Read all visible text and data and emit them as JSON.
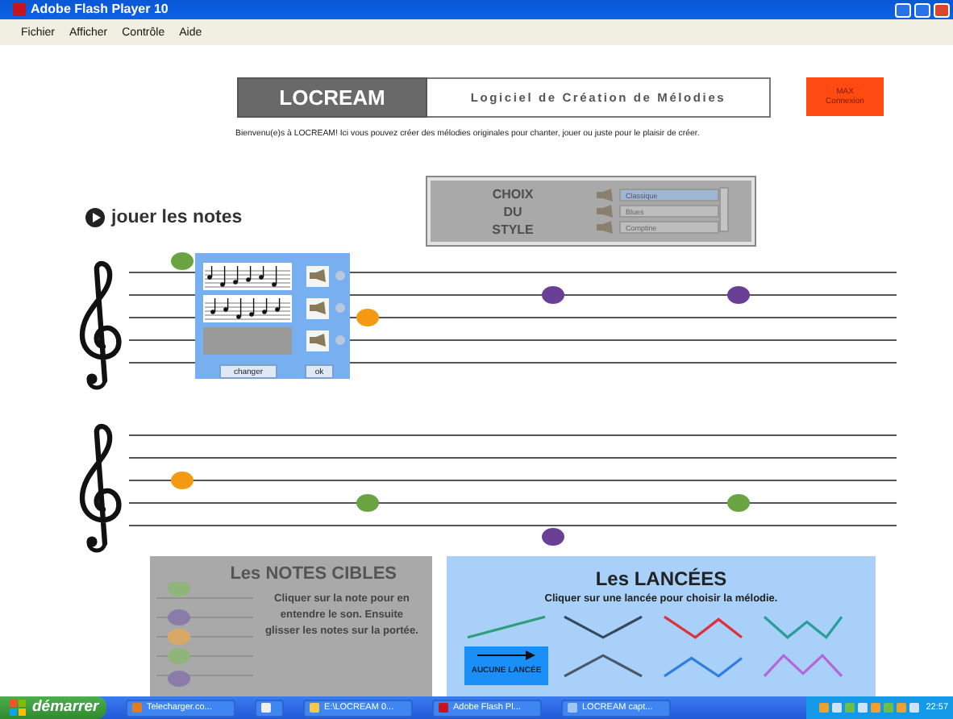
{
  "window": {
    "title": "Adobe Flash Player 10"
  },
  "menu": [
    "Fichier",
    "Afficher",
    "Contrôle",
    "Aide"
  ],
  "header": {
    "logo": "LOCREAM",
    "subtitle": "Logiciel de Création de Mélodies",
    "connect_button": "MAX\nConnexion"
  },
  "welcome": "Bienvenu(e)s à LOCREAM! Ici vous pouvez créer des mélodies originales pour chanter, jouer ou juste pour le plaisir de créer.",
  "play_label": "jouer les notes",
  "style_panel": {
    "heading": "CHOIX DU STYLE",
    "options": [
      {
        "label": "Classique",
        "selected": true
      },
      {
        "label": "Blues",
        "selected": false
      },
      {
        "label": "Comptine",
        "selected": false
      }
    ]
  },
  "staves": [
    {
      "notes": [
        {
          "color": "#6aa341"
        },
        {
          "color": "#f39a12"
        },
        {
          "color": "#6a3f96"
        },
        {
          "color": "#6a3f96"
        }
      ]
    },
    {
      "notes": [
        {
          "color": "#f39a12"
        },
        {
          "color": "#6aa341"
        },
        {
          "color": "#6a3f96"
        },
        {
          "color": "#6aa341"
        }
      ]
    }
  ],
  "melody_popup": {
    "options": [
      {
        "kind": "score",
        "selected": false
      },
      {
        "kind": "score",
        "selected": false
      },
      {
        "kind": "empty",
        "selected": false
      }
    ],
    "buttons": [
      "changer",
      "ok"
    ]
  },
  "target_notes": {
    "title": "Les NOTES CIBLES",
    "text": "Cliquer sur la note pour en entendre le son. Ensuite glisser les notes sur la portée.",
    "notes": [
      {
        "color": "#8fb57a"
      },
      {
        "color": "#8b7ba8"
      },
      {
        "color": "#d9a865"
      },
      {
        "color": "#8fb57a"
      },
      {
        "color": "#8b7ba8"
      }
    ]
  },
  "lancees": {
    "title": "Les LANCÉES",
    "instruction": "Cliquer sur une lancée pour choisir la mélodie.",
    "items": [
      {
        "kind": "rise",
        "color": "#2e9e78"
      },
      {
        "kind": "valley",
        "color": "#34495e"
      },
      {
        "kind": "zigzag",
        "color": "#e0303a"
      },
      {
        "kind": "w",
        "color": "#2a9e9a"
      },
      {
        "kind": "none",
        "label": "AUCUNE LANCÉE"
      },
      {
        "kind": "peak",
        "color": "#4a5868"
      },
      {
        "kind": "wave",
        "color": "#2f7fe0"
      },
      {
        "kind": "m",
        "color": "#b565d8"
      }
    ]
  },
  "taskbar": {
    "start": "démarrer",
    "items": [
      {
        "kind": "window",
        "label": "Telecharger.co..."
      },
      {
        "kind": "icon"
      },
      {
        "kind": "window",
        "label": "E:\\LOCREAM 0..."
      },
      {
        "kind": "window",
        "label": "Adobe Flash Pl..."
      },
      {
        "kind": "window",
        "label": "LOCREAM capt..."
      }
    ],
    "clock": "22:57"
  }
}
